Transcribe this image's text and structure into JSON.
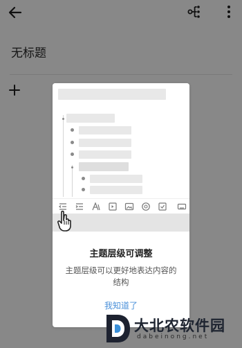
{
  "header": {
    "back_icon": "arrow-left-icon",
    "structure_icon": "mindmap-tree-icon",
    "more_icon": "more-vertical-icon"
  },
  "document": {
    "title": "无标题",
    "add_icon": "plus-icon"
  },
  "guide": {
    "title": "主题层级可调整",
    "description": "主题层级可以更好地表达内容的结构",
    "confirm_label": "我知道了",
    "toolbar_icons": [
      "outdent-icon",
      "indent-icon",
      "text-style-icon",
      "insert-icon",
      "image-icon",
      "emoji-icon",
      "checkbox-icon",
      "keyboard-icon"
    ],
    "hand_icon": "pointing-hand-icon"
  },
  "watermark": {
    "name": "大北农软件园",
    "url": "dabeinong.net"
  },
  "colors": {
    "overlay": "#888888",
    "accent": "#4a90d9",
    "card": "#ffffff"
  }
}
